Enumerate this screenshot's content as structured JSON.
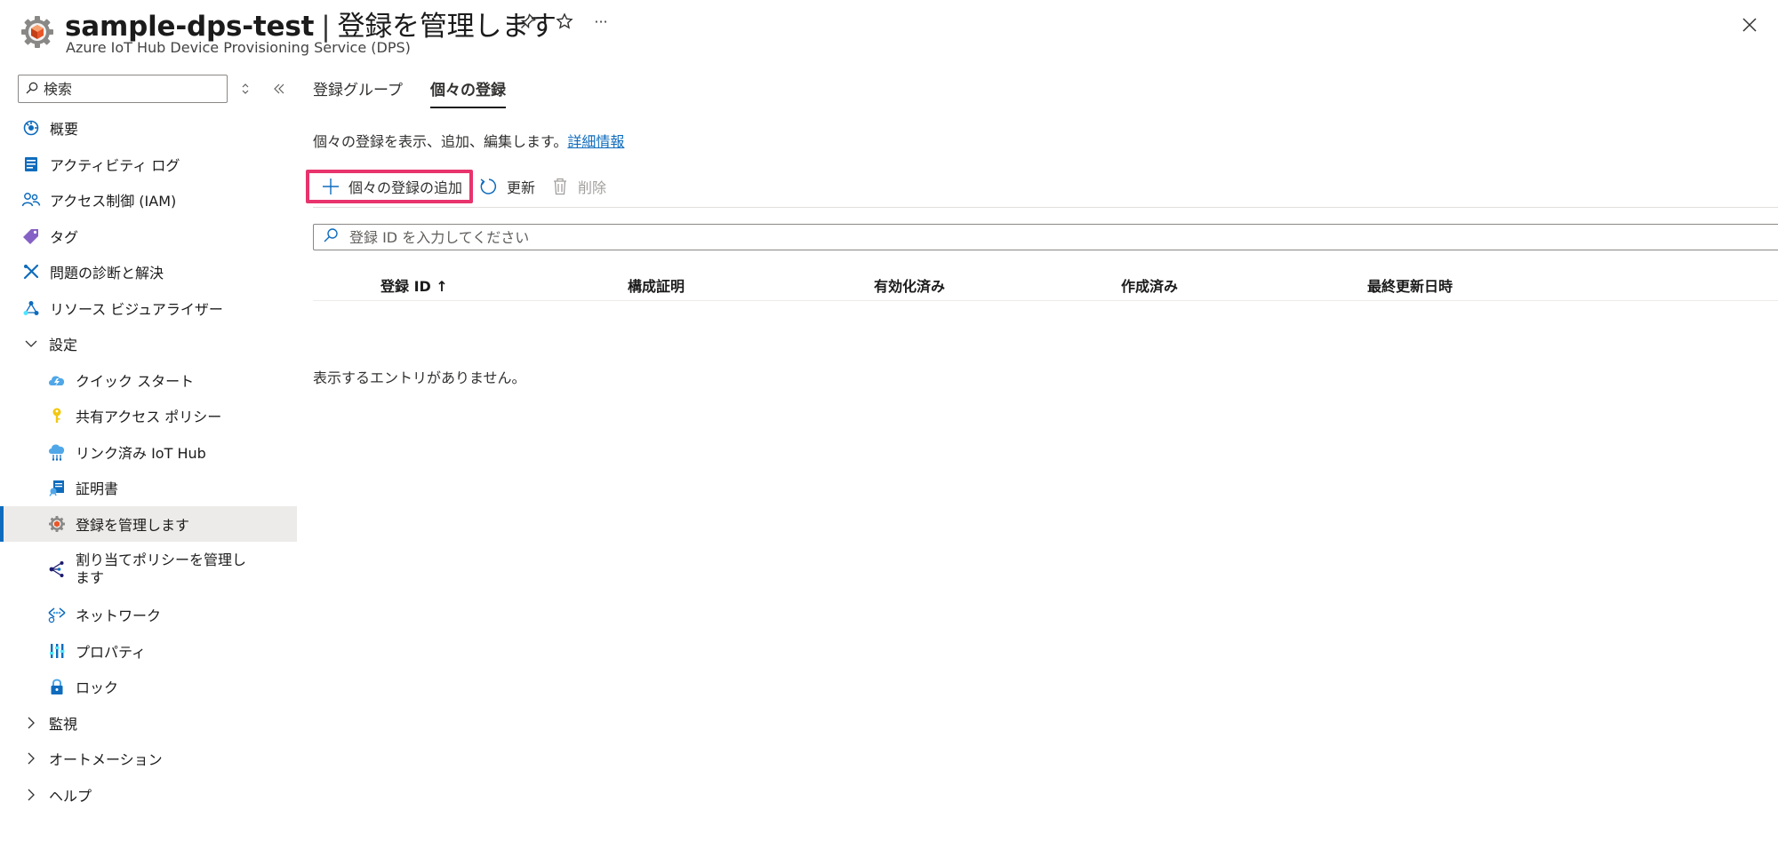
{
  "header": {
    "resource_name": "sample-dps-test",
    "separator": "|",
    "page_title": "登録を管理します",
    "subtitle": "Azure IoT Hub Device Provisioning Service (DPS)",
    "more_label": "···"
  },
  "sidebar": {
    "search_placeholder": "検索",
    "items": [
      {
        "label": "概要",
        "icon": "overview-icon"
      },
      {
        "label": "アクティビティ ログ",
        "icon": "activity-log-icon"
      },
      {
        "label": "アクセス制御 (IAM)",
        "icon": "iam-icon"
      },
      {
        "label": "タグ",
        "icon": "tag-icon"
      },
      {
        "label": "問題の診断と解決",
        "icon": "diagnose-icon"
      },
      {
        "label": "リソース ビジュアライザー",
        "icon": "visualizer-icon"
      }
    ],
    "settings_group": {
      "label": "設定",
      "expanded": true,
      "items": [
        {
          "label": "クイック スタート",
          "icon": "quickstart-icon"
        },
        {
          "label": "共有アクセス ポリシー",
          "icon": "key-icon"
        },
        {
          "label": "リンク済み IoT Hub",
          "icon": "iot-hub-icon"
        },
        {
          "label": "証明書",
          "icon": "certificate-icon"
        },
        {
          "label": "登録を管理します",
          "icon": "gear-icon",
          "selected": true
        },
        {
          "label": "割り当てポリシーを管理します",
          "icon": "allocation-icon"
        },
        {
          "label": "ネットワーク",
          "icon": "network-icon"
        },
        {
          "label": "プロパティ",
          "icon": "properties-icon"
        },
        {
          "label": "ロック",
          "icon": "lock-icon"
        }
      ]
    },
    "collapsed_groups": [
      {
        "label": "監視"
      },
      {
        "label": "オートメーション"
      },
      {
        "label": "ヘルプ"
      }
    ]
  },
  "main": {
    "tabs": [
      {
        "label": "登録グループ",
        "active": false
      },
      {
        "label": "個々の登録",
        "active": true
      }
    ],
    "description": "個々の登録を表示、追加、編集します。",
    "learn_more": "詳細情報",
    "toolbar": {
      "add_label": "個々の登録の追加",
      "refresh_label": "更新",
      "delete_label": "削除"
    },
    "filter_placeholder": "登録 ID を入力してください",
    "table": {
      "columns": [
        "登録 ID ↑",
        "構成証明",
        "有効化済み",
        "作成済み",
        "最終更新日時"
      ],
      "empty_message": "表示するエントリがありません。"
    }
  },
  "colors": {
    "accent": "#0f6cbd",
    "highlight_border": "#e8336d",
    "selected_bg": "#edebe9"
  }
}
